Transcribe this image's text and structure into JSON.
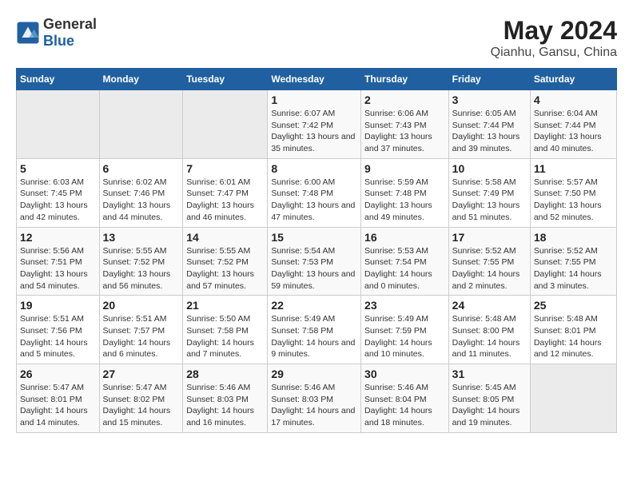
{
  "logo": {
    "general": "General",
    "blue": "Blue"
  },
  "title": "May 2024",
  "subtitle": "Qianhu, Gansu, China",
  "weekdays": [
    "Sunday",
    "Monday",
    "Tuesday",
    "Wednesday",
    "Thursday",
    "Friday",
    "Saturday"
  ],
  "weeks": [
    [
      {
        "day": "",
        "sunrise": "",
        "sunset": "",
        "daylight": ""
      },
      {
        "day": "",
        "sunrise": "",
        "sunset": "",
        "daylight": ""
      },
      {
        "day": "",
        "sunrise": "",
        "sunset": "",
        "daylight": ""
      },
      {
        "day": "1",
        "sunrise": "Sunrise: 6:07 AM",
        "sunset": "Sunset: 7:42 PM",
        "daylight": "Daylight: 13 hours and 35 minutes."
      },
      {
        "day": "2",
        "sunrise": "Sunrise: 6:06 AM",
        "sunset": "Sunset: 7:43 PM",
        "daylight": "Daylight: 13 hours and 37 minutes."
      },
      {
        "day": "3",
        "sunrise": "Sunrise: 6:05 AM",
        "sunset": "Sunset: 7:44 PM",
        "daylight": "Daylight: 13 hours and 39 minutes."
      },
      {
        "day": "4",
        "sunrise": "Sunrise: 6:04 AM",
        "sunset": "Sunset: 7:44 PM",
        "daylight": "Daylight: 13 hours and 40 minutes."
      }
    ],
    [
      {
        "day": "5",
        "sunrise": "Sunrise: 6:03 AM",
        "sunset": "Sunset: 7:45 PM",
        "daylight": "Daylight: 13 hours and 42 minutes."
      },
      {
        "day": "6",
        "sunrise": "Sunrise: 6:02 AM",
        "sunset": "Sunset: 7:46 PM",
        "daylight": "Daylight: 13 hours and 44 minutes."
      },
      {
        "day": "7",
        "sunrise": "Sunrise: 6:01 AM",
        "sunset": "Sunset: 7:47 PM",
        "daylight": "Daylight: 13 hours and 46 minutes."
      },
      {
        "day": "8",
        "sunrise": "Sunrise: 6:00 AM",
        "sunset": "Sunset: 7:48 PM",
        "daylight": "Daylight: 13 hours and 47 minutes."
      },
      {
        "day": "9",
        "sunrise": "Sunrise: 5:59 AM",
        "sunset": "Sunset: 7:48 PM",
        "daylight": "Daylight: 13 hours and 49 minutes."
      },
      {
        "day": "10",
        "sunrise": "Sunrise: 5:58 AM",
        "sunset": "Sunset: 7:49 PM",
        "daylight": "Daylight: 13 hours and 51 minutes."
      },
      {
        "day": "11",
        "sunrise": "Sunrise: 5:57 AM",
        "sunset": "Sunset: 7:50 PM",
        "daylight": "Daylight: 13 hours and 52 minutes."
      }
    ],
    [
      {
        "day": "12",
        "sunrise": "Sunrise: 5:56 AM",
        "sunset": "Sunset: 7:51 PM",
        "daylight": "Daylight: 13 hours and 54 minutes."
      },
      {
        "day": "13",
        "sunrise": "Sunrise: 5:55 AM",
        "sunset": "Sunset: 7:52 PM",
        "daylight": "Daylight: 13 hours and 56 minutes."
      },
      {
        "day": "14",
        "sunrise": "Sunrise: 5:55 AM",
        "sunset": "Sunset: 7:52 PM",
        "daylight": "Daylight: 13 hours and 57 minutes."
      },
      {
        "day": "15",
        "sunrise": "Sunrise: 5:54 AM",
        "sunset": "Sunset: 7:53 PM",
        "daylight": "Daylight: 13 hours and 59 minutes."
      },
      {
        "day": "16",
        "sunrise": "Sunrise: 5:53 AM",
        "sunset": "Sunset: 7:54 PM",
        "daylight": "Daylight: 14 hours and 0 minutes."
      },
      {
        "day": "17",
        "sunrise": "Sunrise: 5:52 AM",
        "sunset": "Sunset: 7:55 PM",
        "daylight": "Daylight: 14 hours and 2 minutes."
      },
      {
        "day": "18",
        "sunrise": "Sunrise: 5:52 AM",
        "sunset": "Sunset: 7:55 PM",
        "daylight": "Daylight: 14 hours and 3 minutes."
      }
    ],
    [
      {
        "day": "19",
        "sunrise": "Sunrise: 5:51 AM",
        "sunset": "Sunset: 7:56 PM",
        "daylight": "Daylight: 14 hours and 5 minutes."
      },
      {
        "day": "20",
        "sunrise": "Sunrise: 5:51 AM",
        "sunset": "Sunset: 7:57 PM",
        "daylight": "Daylight: 14 hours and 6 minutes."
      },
      {
        "day": "21",
        "sunrise": "Sunrise: 5:50 AM",
        "sunset": "Sunset: 7:58 PM",
        "daylight": "Daylight: 14 hours and 7 minutes."
      },
      {
        "day": "22",
        "sunrise": "Sunrise: 5:49 AM",
        "sunset": "Sunset: 7:58 PM",
        "daylight": "Daylight: 14 hours and 9 minutes."
      },
      {
        "day": "23",
        "sunrise": "Sunrise: 5:49 AM",
        "sunset": "Sunset: 7:59 PM",
        "daylight": "Daylight: 14 hours and 10 minutes."
      },
      {
        "day": "24",
        "sunrise": "Sunrise: 5:48 AM",
        "sunset": "Sunset: 8:00 PM",
        "daylight": "Daylight: 14 hours and 11 minutes."
      },
      {
        "day": "25",
        "sunrise": "Sunrise: 5:48 AM",
        "sunset": "Sunset: 8:01 PM",
        "daylight": "Daylight: 14 hours and 12 minutes."
      }
    ],
    [
      {
        "day": "26",
        "sunrise": "Sunrise: 5:47 AM",
        "sunset": "Sunset: 8:01 PM",
        "daylight": "Daylight: 14 hours and 14 minutes."
      },
      {
        "day": "27",
        "sunrise": "Sunrise: 5:47 AM",
        "sunset": "Sunset: 8:02 PM",
        "daylight": "Daylight: 14 hours and 15 minutes."
      },
      {
        "day": "28",
        "sunrise": "Sunrise: 5:46 AM",
        "sunset": "Sunset: 8:03 PM",
        "daylight": "Daylight: 14 hours and 16 minutes."
      },
      {
        "day": "29",
        "sunrise": "Sunrise: 5:46 AM",
        "sunset": "Sunset: 8:03 PM",
        "daylight": "Daylight: 14 hours and 17 minutes."
      },
      {
        "day": "30",
        "sunrise": "Sunrise: 5:46 AM",
        "sunset": "Sunset: 8:04 PM",
        "daylight": "Daylight: 14 hours and 18 minutes."
      },
      {
        "day": "31",
        "sunrise": "Sunrise: 5:45 AM",
        "sunset": "Sunset: 8:05 PM",
        "daylight": "Daylight: 14 hours and 19 minutes."
      },
      {
        "day": "",
        "sunrise": "",
        "sunset": "",
        "daylight": ""
      }
    ]
  ]
}
